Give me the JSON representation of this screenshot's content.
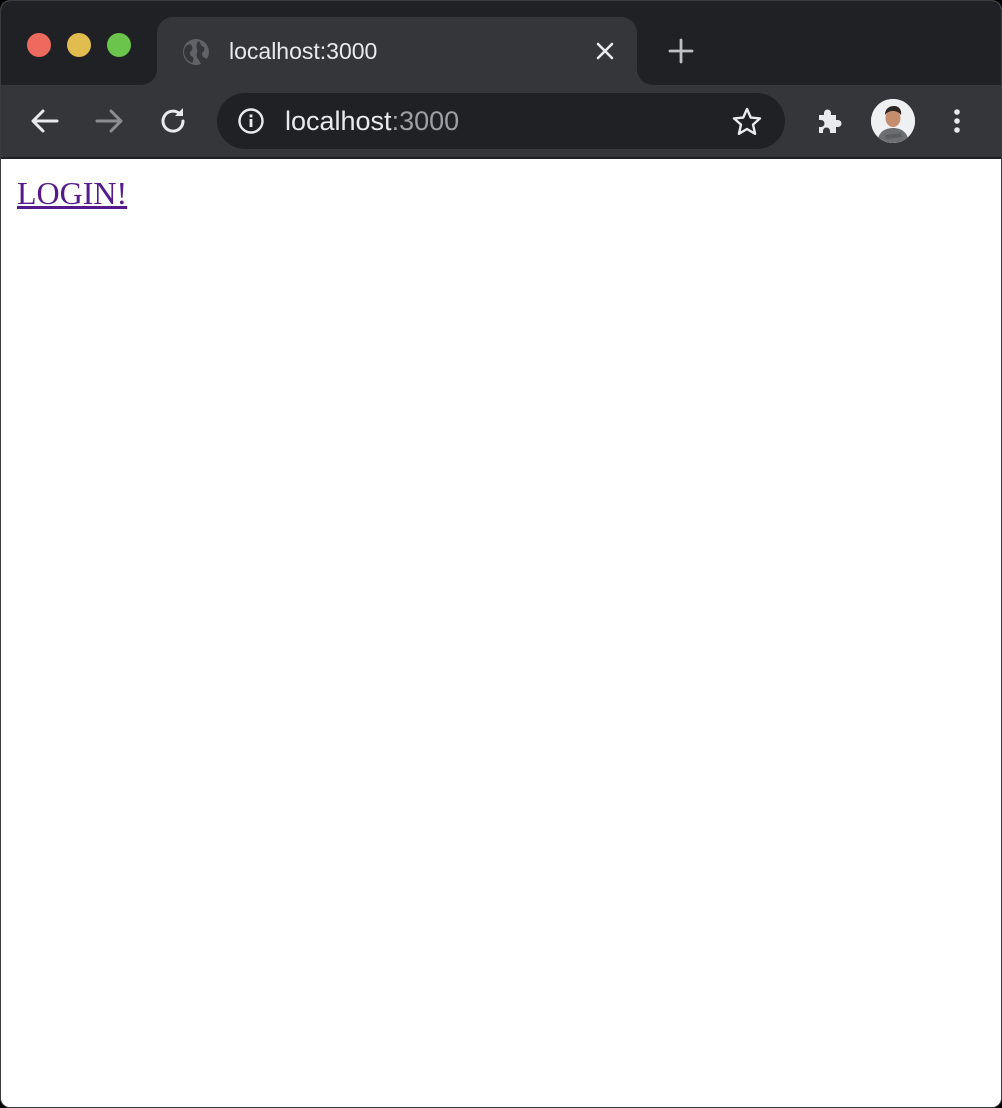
{
  "window": {
    "traffic_colors": {
      "close": "#ed6a5e",
      "minimize": "#e0bd4e",
      "zoom": "#6bc44b"
    }
  },
  "tab": {
    "title": "localhost:3000",
    "favicon": "globe-icon"
  },
  "toolbar": {
    "back_icon": "arrow-left-icon",
    "forward_icon": "arrow-right-icon",
    "reload_icon": "reload-icon",
    "extensions_icon": "puzzle-icon",
    "menu_icon": "kebab-menu-icon"
  },
  "omnibox": {
    "host": "localhost",
    "port": ":3000",
    "info_icon": "info-icon",
    "bookmark_icon": "star-icon"
  },
  "page": {
    "link_text": "LOGIN!",
    "link_color": "#551a8b"
  }
}
